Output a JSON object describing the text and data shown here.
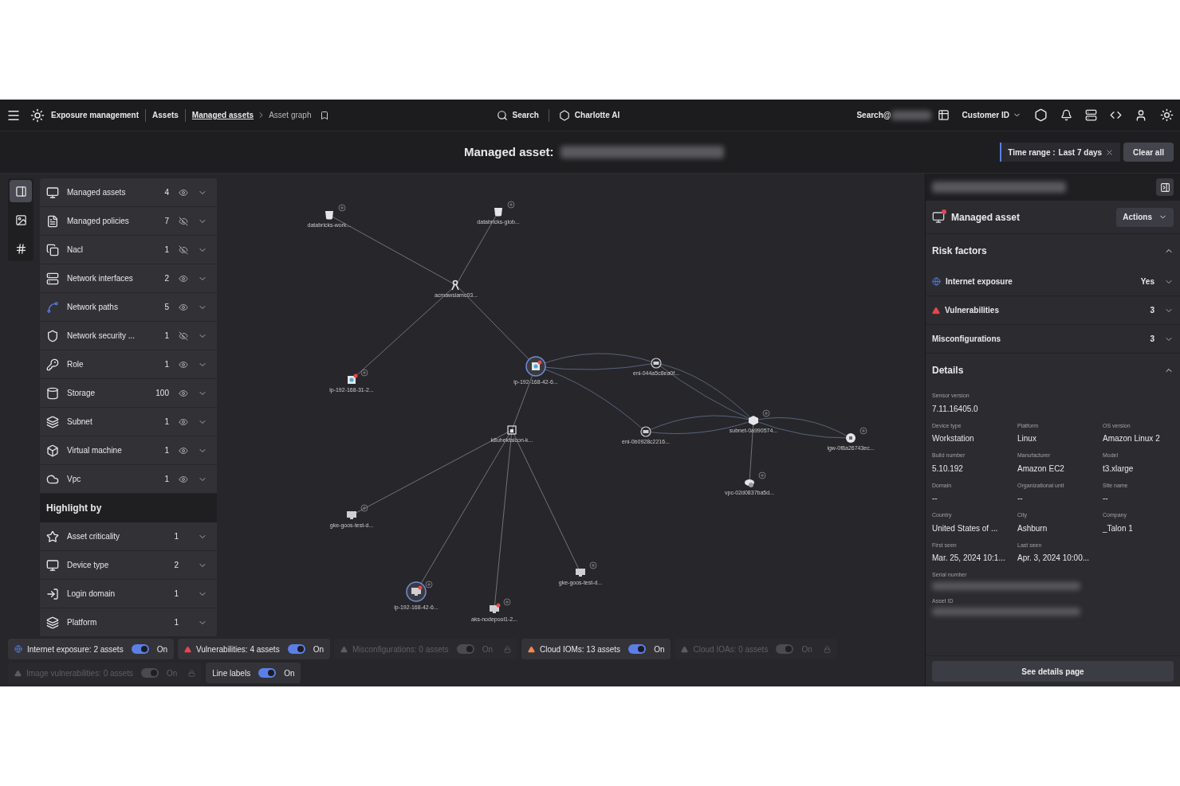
{
  "topbar": {
    "product": "Exposure management",
    "crumbs": [
      {
        "label": "Assets",
        "link": false
      },
      {
        "label": "Managed assets",
        "link": true
      },
      {
        "label": "Asset graph",
        "link": false
      }
    ],
    "search": "Search",
    "assistant": "Charlotte AI",
    "search_scope": "Search@",
    "customer": "Customer ID"
  },
  "title": {
    "label": "Managed asset:"
  },
  "filter": {
    "name": "Time range :",
    "value": "Last 7 days",
    "clear": "Clear all"
  },
  "rail": [
    {
      "kind": "panel",
      "selected": true
    },
    {
      "kind": "image",
      "selected": false
    },
    {
      "kind": "grid",
      "selected": false
    }
  ],
  "asset_types": [
    {
      "kind": "monitor",
      "label": "Managed assets",
      "count": "4",
      "visible": true
    },
    {
      "kind": "policy",
      "label": "Managed policies",
      "count": "7",
      "visible": false
    },
    {
      "kind": "nacl",
      "label": "Nacl",
      "count": "1",
      "visible": false
    },
    {
      "kind": "interface",
      "label": "Network interfaces",
      "count": "2",
      "visible": true
    },
    {
      "kind": "path",
      "label": "Network paths",
      "count": "5",
      "visible": true
    },
    {
      "kind": "security",
      "label": "Network security ...",
      "count": "1",
      "visible": false
    },
    {
      "kind": "role",
      "label": "Role",
      "count": "1",
      "visible": true
    },
    {
      "kind": "storage",
      "label": "Storage",
      "count": "100",
      "visible": true
    },
    {
      "kind": "subnet",
      "label": "Subnet",
      "count": "1",
      "visible": true
    },
    {
      "kind": "vm",
      "label": "Virtual machine",
      "count": "1",
      "visible": true
    },
    {
      "kind": "vpc",
      "label": "Vpc",
      "count": "1",
      "visible": true
    }
  ],
  "highlight": {
    "title": "Highlight by",
    "items": [
      {
        "kind": "star",
        "label": "Asset criticality",
        "count": "1"
      },
      {
        "kind": "device",
        "label": "Device type",
        "count": "2"
      },
      {
        "kind": "login",
        "label": "Login domain",
        "count": "1"
      },
      {
        "kind": "platform",
        "label": "Platform",
        "count": "1"
      }
    ]
  },
  "graph": {
    "nodes": [
      {
        "kind": "storage",
        "label": "databricks-work...",
        "expandable": true,
        "alert": false,
        "ring": false
      },
      {
        "kind": "storage",
        "label": "databricks-glob...",
        "expandable": true,
        "alert": false,
        "ring": false
      },
      {
        "kind": "role",
        "label": "acmawsiamc03...",
        "expandable": false,
        "alert": false,
        "ring": false
      },
      {
        "kind": "vm",
        "label": "ip-192-168-31-2...",
        "expandable": true,
        "alert": true,
        "ring": false
      },
      {
        "kind": "vm",
        "label": "ip-192-168-42-6...",
        "expandable": false,
        "alert": true,
        "ring": true
      },
      {
        "kind": "interface",
        "label": "eni-044a5c8ea0f...",
        "expandable": false,
        "alert": false,
        "ring": false
      },
      {
        "kind": "interface",
        "label": "eni-0b0928c2216...",
        "expandable": false,
        "alert": false,
        "ring": false
      },
      {
        "kind": "subnet",
        "label": "subnet-0a990574...",
        "expandable": true,
        "alert": false,
        "ring": false
      },
      {
        "kind": "gateway",
        "label": "igw-0f8a26743ec...",
        "expandable": true,
        "alert": false,
        "ring": false
      },
      {
        "kind": "vpc",
        "label": "vpc-02d0837ba5d...",
        "expandable": true,
        "alert": false,
        "ring": false
      },
      {
        "kind": "cluster",
        "label": "k8uhekfalcon-k...",
        "expandable": false,
        "alert": false,
        "ring": false
      },
      {
        "kind": "monitor",
        "label": "gke-goos-test-d...",
        "expandable": true,
        "alert": false,
        "ring": false
      },
      {
        "kind": "monitor",
        "label": "ip-192-168-42-6...",
        "expandable": true,
        "alert": true,
        "ring": true
      },
      {
        "kind": "monitor",
        "label": "aks-nodepool1-2...",
        "expandable": true,
        "alert": true,
        "ring": false
      },
      {
        "kind": "monitor",
        "label": "gke-goos-test-d...",
        "expandable": true,
        "alert": false,
        "ring": false
      }
    ]
  },
  "toggles": [
    {
      "kind": "globe",
      "label": "Internet exposure: 2 assets",
      "state": "On",
      "on": true,
      "disabled": false
    },
    {
      "kind": "warning",
      "label": "Vulnerabilities: 4 assets",
      "state": "On",
      "on": true,
      "disabled": false
    },
    {
      "kind": "muted",
      "label": "Misconfigurations: 0 assets",
      "state": "On",
      "on": true,
      "disabled": true
    },
    {
      "kind": "alert",
      "label": "Cloud IOMs: 13 assets",
      "state": "On",
      "on": true,
      "disabled": false
    },
    {
      "kind": "muted",
      "label": "Cloud IOAs: 0 assets",
      "state": "On",
      "on": true,
      "disabled": true
    },
    {
      "kind": "muted",
      "label": "Image vulnerabilities: 0 assets",
      "state": "On",
      "on": true,
      "disabled": true
    },
    {
      "kind": "none",
      "label": "Line labels",
      "state": "On",
      "on": true,
      "disabled": false
    }
  ],
  "panel": {
    "asset_title": "Managed asset",
    "actions": "Actions",
    "risk": {
      "title": "Risk factors",
      "expanded": true,
      "items": [
        {
          "kind": "globe",
          "label": "Internet exposure",
          "value": "Yes"
        },
        {
          "kind": "warning",
          "label": "Vulnerabilities",
          "value": "3"
        },
        {
          "kind": "none",
          "label": "Misconfigurations",
          "value": "3"
        }
      ]
    },
    "details": {
      "title": "Details",
      "expanded": true,
      "rows": [
        [
          {
            "label": "Sensor version",
            "value": "7.11.16405.0"
          }
        ],
        [
          {
            "label": "Device type",
            "value": "Workstation"
          },
          {
            "label": "Platform",
            "value": "Linux"
          },
          {
            "label": "OS version",
            "value": "Amazon Linux 2"
          }
        ],
        [
          {
            "label": "Build number",
            "value": "5.10.192"
          },
          {
            "label": "Manufacturer",
            "value": "Amazon EC2"
          },
          {
            "label": "Model",
            "value": "t3.xlarge"
          }
        ],
        [
          {
            "label": "Domain",
            "value": "--"
          },
          {
            "label": "Organizational unit",
            "value": "--"
          },
          {
            "label": "Site name",
            "value": "--"
          }
        ],
        [
          {
            "label": "Country",
            "value": "United States of ..."
          },
          {
            "label": "City",
            "value": "Ashburn"
          },
          {
            "label": "Company",
            "value": "_Talon 1"
          }
        ],
        [
          {
            "label": "First seen",
            "value": "Mar. 25, 2024 10:1..."
          },
          {
            "label": "Last seen",
            "value": "Apr. 3, 2024 10:00..."
          }
        ],
        [
          {
            "label": "Serial number"
          }
        ],
        [
          {
            "label": "Asset ID"
          }
        ]
      ]
    },
    "button": "See details page"
  }
}
